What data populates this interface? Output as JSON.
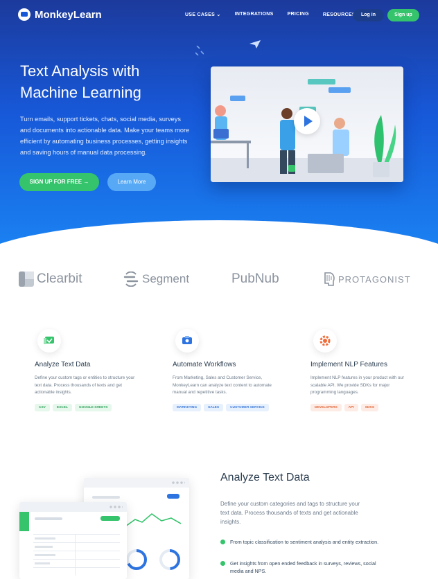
{
  "nav": {
    "brand": "MonkeyLearn",
    "menu": [
      "USE CASES ⌄",
      "INTEGRATIONS",
      "PRICING",
      "RESOURCES ⌄"
    ],
    "login": "Log in",
    "signup": "Sign up"
  },
  "hero": {
    "title": "Text Analysis with Machine Learning",
    "description": "Turn emails, support tickets, chats, social media, surveys and documents into actionable data. Make your teams more efficient by automating business processes, getting insights and saving hours of manual data processing.",
    "cta_primary": "SIGN UP FOR FREE  →",
    "cta_secondary": "Learn More"
  },
  "partners": [
    "Clearbit",
    "Segment",
    "PubNub",
    "PROTAGONIST"
  ],
  "features": [
    {
      "title": "Analyze Text Data",
      "text": "Define your custom tags or entities to structure your text data. Process thousands of texts and get actionable insights.",
      "tags": [
        "CSV",
        "EXCEL",
        "GOOGLE SHEETS"
      ],
      "icon": "check-chat-icon",
      "color": "#35c46c"
    },
    {
      "title": "Automate Workflows",
      "text": "From Marketing, Sales and Customer Service, MonkeyLearn can analyze text content to automate manual and repetitive tasks.",
      "tags": [
        "MARKETING",
        "SALES",
        "CUSTOMER SERVICE"
      ],
      "icon": "workflow-icon",
      "color": "#2e74e0"
    },
    {
      "title": "Implement NLP Features",
      "text": "Implement NLP features in your product with our scalable API. We provide SDKs for major programming languages.",
      "tags": [
        "DEVELOPERS",
        "API",
        "SDKS"
      ],
      "icon": "gear-icon",
      "color": "#f06d3a"
    }
  ],
  "analyze": {
    "title": "Analyze Text Data",
    "description": "Define your custom categories and tags to structure your text data. Process thousands of texts and get actionable insights.",
    "bullets": [
      "From topic classification to sentiment analysis and entity extraction.",
      "Get insights from open ended feedback in surveys, reviews, social media and NPS."
    ]
  }
}
